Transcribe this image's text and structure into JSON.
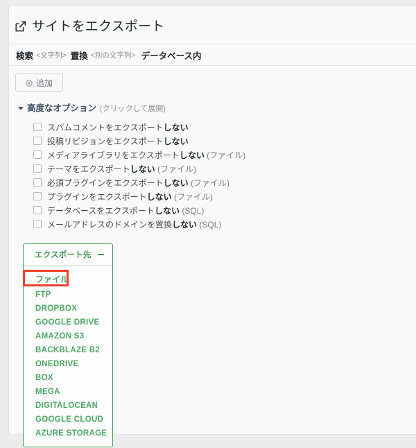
{
  "header": {
    "icon": "export-icon",
    "title": "サイトをエクスポート"
  },
  "search_replace": {
    "search_label": "検索",
    "search_placeholder": "<文字列>",
    "replace_label": "置換",
    "replace_placeholder": "<別の文字列>",
    "scope_label": "データベース内"
  },
  "toolbar": {
    "add_label": "追加",
    "add_icon": "plus-circle-icon"
  },
  "advanced": {
    "caret_icon": "caret-down-icon",
    "label": "高度なオプション",
    "hint": "(クリックして展開)",
    "options": [
      {
        "text": "スパムコメントをエクスポート",
        "bold": "しない",
        "suffix": "",
        "checked": false
      },
      {
        "text": "投稿リビジョンをエクスポート",
        "bold": "しない",
        "suffix": "",
        "checked": false
      },
      {
        "text": "メディアライブラリをエクスポート",
        "bold": "しない",
        "suffix": " (ファイル)",
        "checked": false
      },
      {
        "text": "テーマをエクスポート",
        "bold": "しない",
        "suffix": " (ファイル)",
        "checked": false
      },
      {
        "text": "必須プラグインをエクスポート",
        "bold": "しない",
        "suffix": " (ファイル)",
        "checked": false
      },
      {
        "text": "プラグインをエクスポート",
        "bold": "しない",
        "suffix": " (ファイル)",
        "checked": false
      },
      {
        "text": "データベースをエクスポート",
        "bold": "しない",
        "suffix": " (SQL)",
        "checked": false
      },
      {
        "text": "メールアドレスのドメインを置換",
        "bold": "しない",
        "suffix": " (SQL)",
        "checked": false
      }
    ]
  },
  "destination_panel": {
    "title": "エクスポート先",
    "collapse_icon": "minus-icon",
    "accent_color": "#45a05a",
    "highlight_color": "#f0402c",
    "items": [
      {
        "label": "ファイル",
        "japanese": true,
        "highlighted": true
      },
      {
        "label": "FTP",
        "japanese": false,
        "highlighted": false
      },
      {
        "label": "DROPBOX",
        "japanese": false,
        "highlighted": false
      },
      {
        "label": "GOOGLE DRIVE",
        "japanese": false,
        "highlighted": false
      },
      {
        "label": "AMAZON S3",
        "japanese": false,
        "highlighted": false
      },
      {
        "label": "BACKBLAZE B2",
        "japanese": false,
        "highlighted": false
      },
      {
        "label": "ONEDRIVE",
        "japanese": false,
        "highlighted": false
      },
      {
        "label": "BOX",
        "japanese": false,
        "highlighted": false
      },
      {
        "label": "MEGA",
        "japanese": false,
        "highlighted": false
      },
      {
        "label": "DIGITALOCEAN",
        "japanese": false,
        "highlighted": false
      },
      {
        "label": "GOOGLE CLOUD",
        "japanese": false,
        "highlighted": false
      },
      {
        "label": "AZURE STORAGE",
        "japanese": false,
        "highlighted": false
      }
    ]
  }
}
